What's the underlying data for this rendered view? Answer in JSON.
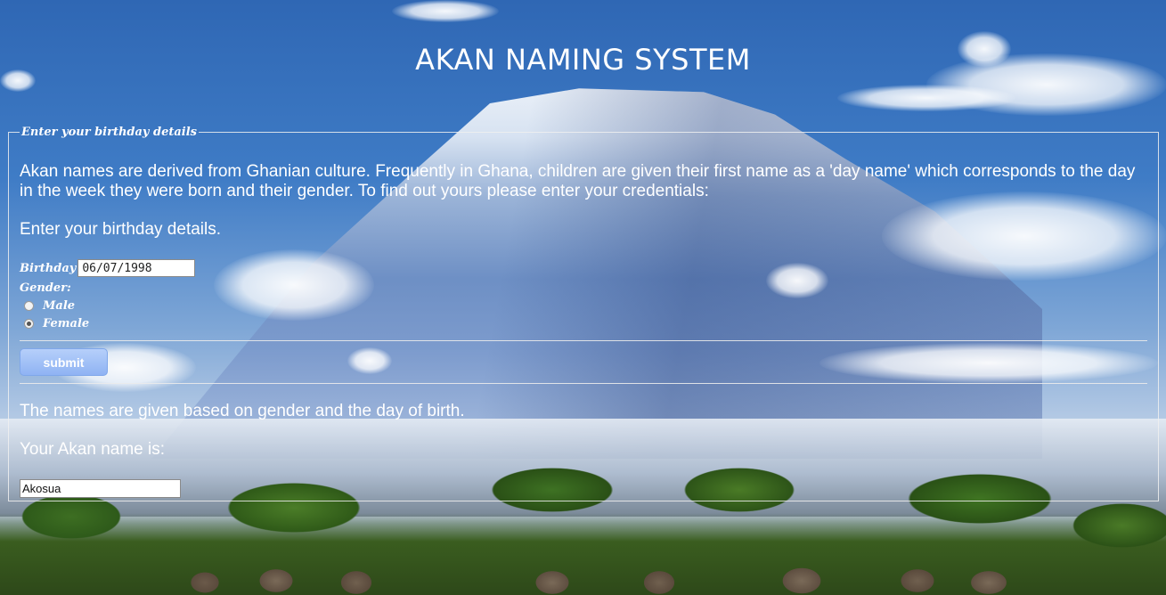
{
  "page": {
    "title": "AKAN NAMING SYSTEM"
  },
  "form": {
    "legend": "Enter your birthday details",
    "intro": "Akan names are derived from Ghanian culture. Frequently in Ghana, children are given their first name as a 'day name' which corresponds to the day in the week they were born and their gender. To find out yours please enter your credentials:",
    "prompt": "Enter your birthday details.",
    "birthday_label": "Birthday",
    "birthday_value": "06/07/1998",
    "gender_label": "Gender:",
    "gender_options": [
      {
        "label": "Male",
        "checked": false
      },
      {
        "label": "Female",
        "checked": true
      }
    ],
    "submit_label": "submit"
  },
  "result": {
    "info": "The names are given based on gender and the day of birth.",
    "label": "Your Akan name is:",
    "value": "Akosua"
  },
  "colors": {
    "text": "#ffffff",
    "button": "#9bbcf5",
    "border": "#f0f0f0"
  },
  "background": {
    "scene": "mountain-landscape-image"
  }
}
